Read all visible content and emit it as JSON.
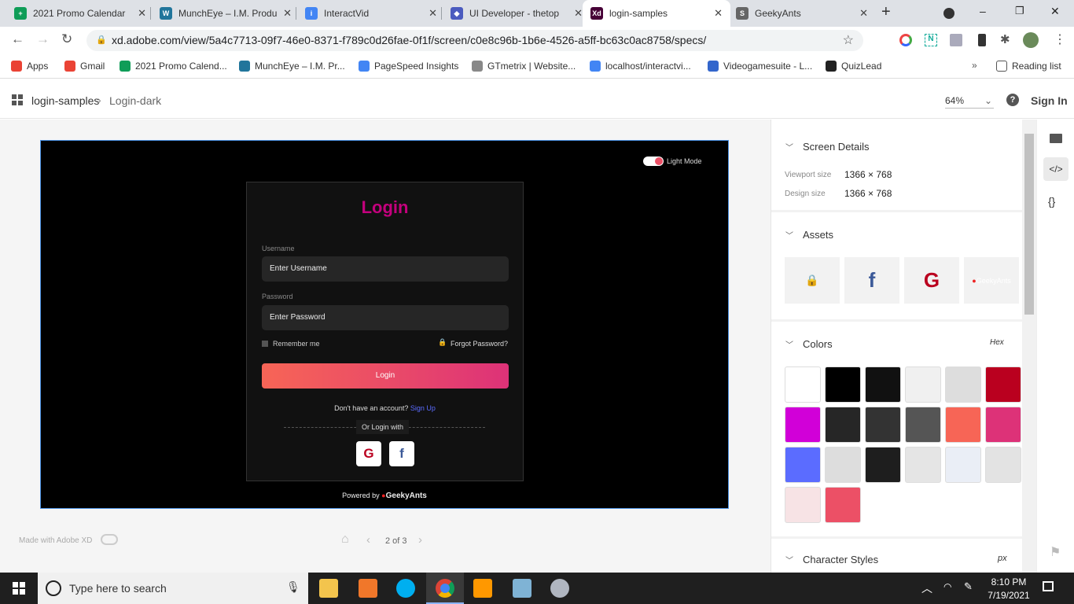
{
  "browser": {
    "tabs": [
      {
        "title": "2021 Promo Calendar",
        "color": "#0f9d58",
        "glyph": "+"
      },
      {
        "title": "MunchEye – I.M. Produ",
        "color": "#21759b",
        "glyph": "W"
      },
      {
        "title": "InteractVid",
        "color": "#4285f4",
        "glyph": "i"
      },
      {
        "title": "UI Developer - thetop",
        "color": "#4b5bbf",
        "glyph": "◆"
      },
      {
        "title": "login-samples",
        "color": "#470137",
        "glyph": "Xd"
      },
      {
        "title": "GeekyAnts",
        "color": "#666",
        "glyph": "S"
      }
    ],
    "url": "xd.adobe.com/view/5a4c7713-09f7-46e0-8371-f789c0d26fae-0f1f/screen/c0e8c96b-1b6e-4526-a5ff-bc63c0ac8758/specs/",
    "bookmarks": [
      "Apps",
      "Gmail",
      "2021 Promo Calend...",
      "MunchEye – I.M. Pr...",
      "PageSpeed Insights",
      "GTmetrix | Website...",
      "localhost/interactvi...",
      "Videogamesuite - L...",
      "QuizLead"
    ],
    "reading_list": "Reading list"
  },
  "xd": {
    "breadcrumb": [
      "login-samples",
      "Login-dark"
    ],
    "zoom": "64%",
    "sign_in": "Sign In",
    "made_with": "Made with Adobe XD",
    "pager": "2 of 3"
  },
  "artboard": {
    "light_mode": "Light Mode",
    "title": "Login",
    "username_label": "Username",
    "username_placeholder": "Enter Username",
    "password_label": "Password",
    "password_placeholder": "Enter Password",
    "remember": "Remember me",
    "forgot": "Forgot Password?",
    "login_button": "Login",
    "no_account": "Don't have an account?",
    "sign_up": "Sign Up",
    "or_login": "Or Login with",
    "powered": "Powered by",
    "brand": "GeekyAnts"
  },
  "panel": {
    "screen_details": "Screen Details",
    "viewport_label": "Viewport size",
    "viewport_value": "1366 × 768",
    "design_label": "Design size",
    "design_value": "1366 × 768",
    "assets": "Assets",
    "colors": "Colors",
    "hex": "Hex",
    "swatches": [
      "#FFFFFF",
      "#000000",
      "#111111",
      "#F0F0F0",
      "#DDDDDD",
      "#BA001F",
      "#D100D8",
      "#262626",
      "#333333",
      "#555555",
      "#F76556",
      "#DD3278",
      "#5B6CFF",
      "#DDDDDD",
      "#1E1E1E",
      "#E5E5E5",
      "#EAEEF6",
      "#E3E3E3",
      "#F7E3E5",
      "#EC5066"
    ],
    "character_styles": "Character Styles",
    "px": "px"
  },
  "taskbar": {
    "search": "Type here to search",
    "time": "8:10 PM",
    "date": "7/19/2021"
  }
}
